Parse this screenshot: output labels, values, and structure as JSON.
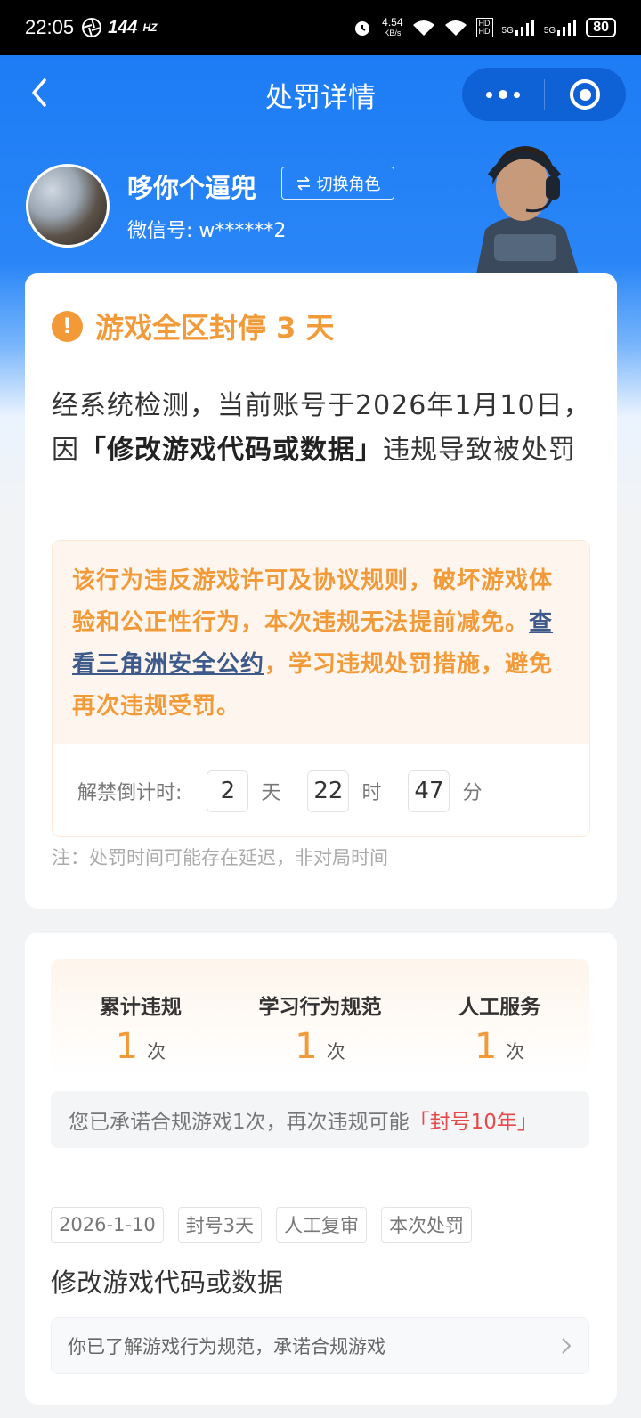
{
  "status_bar": {
    "time": "22:05",
    "refresh_rate": "144",
    "refresh_unit": "HZ",
    "net_speed": "4.54",
    "net_unit": "KB/s",
    "signal_1": "5G",
    "signal_2": "5G",
    "battery": "80"
  },
  "nav": {
    "title": "处罚详情"
  },
  "profile": {
    "username": "哆你个逼兜",
    "switch_role": "切换角色",
    "wechat_id": "微信号: w******2"
  },
  "penalty": {
    "title": "游戏全区封停 3 天",
    "desc_pre": "经系统检测，当前账号于2026年1月10日，因",
    "desc_bold": "「修改游戏代码或数据」",
    "desc_post": "违规导致被处罚",
    "notice_pre": "该行为违反游戏许可及协议规则，破坏游戏体验和公正性行为，本次违规无法提前减免。",
    "notice_link": "查看三角洲安全公约",
    "notice_post": "，学习违规处罚措施，避免再次违规受罚。",
    "countdown_label": "解禁倒计时:",
    "days": "2",
    "days_unit": "天",
    "hours": "22",
    "hours_unit": "时",
    "minutes": "47",
    "minutes_unit": "分",
    "note": "注：处罚时间可能存在延迟，非对局时间"
  },
  "stats": [
    {
      "label": "累计违规",
      "value": "1",
      "unit": "次"
    },
    {
      "label": "学习行为规范",
      "value": "1",
      "unit": "次"
    },
    {
      "label": "人工服务",
      "value": "1",
      "unit": "次"
    }
  ],
  "promise": {
    "text": "您已承诺合规游戏1次，再次违规可能",
    "highlight": "「封号10年」"
  },
  "record": {
    "tags": [
      "2026-1-10",
      "封号3天",
      "人工复审",
      "本次处罚"
    ],
    "violation": "修改游戏代码或数据",
    "learn_text": "你已了解游戏行为规范，承诺合规游戏"
  },
  "colors": {
    "brand_blue": "#1d7cf5",
    "warning_orange": "#f29a38",
    "danger_red": "#e54a4a"
  }
}
